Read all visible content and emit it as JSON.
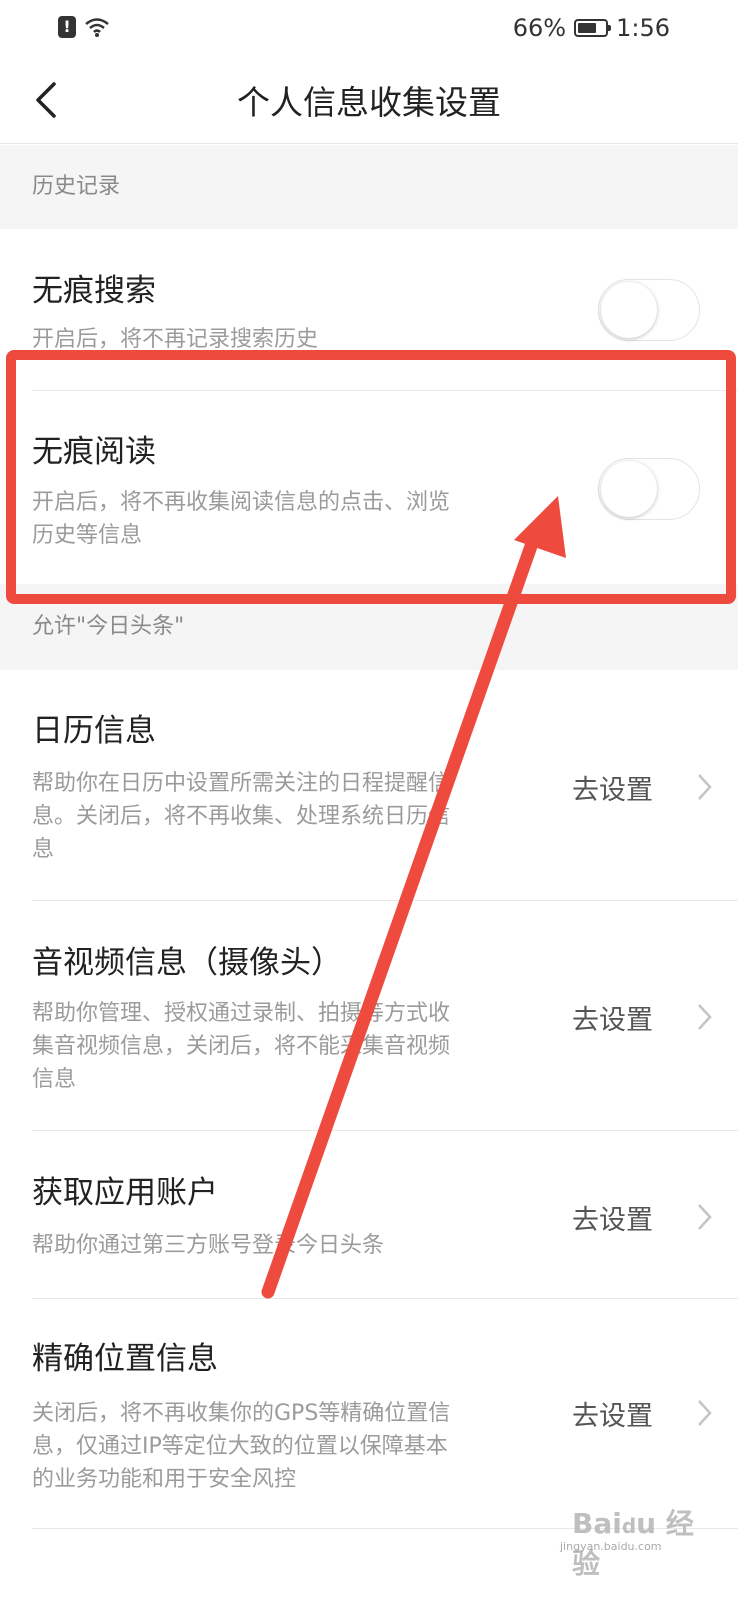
{
  "status_bar": {
    "battery_percent": "66%",
    "battery_level": 0.66,
    "time": "1:56",
    "icons": [
      "alert-icon",
      "wifi-icon",
      "battery-icon"
    ]
  },
  "header": {
    "title": "个人信息收集设置",
    "back_icon": "chevron-left-icon"
  },
  "sections": {
    "history": {
      "label": "历史记录"
    },
    "allow": {
      "label": "允许\"今日头条\""
    }
  },
  "toggles": [
    {
      "title": "无痕搜索",
      "desc": "开启后，将不再记录搜索历史",
      "on": false
    },
    {
      "title": "无痕阅读",
      "desc_line1": "开启后，将不再收集阅读信息的点击、浏览",
      "desc_line2": "历史等信息",
      "on": false
    }
  ],
  "settings": [
    {
      "title": "日历信息",
      "desc_lines": [
        "帮助你在日历中设置所需关注的日程提醒信",
        "息。关闭后，将不再收集、处理系统日历信",
        "息"
      ],
      "action": "去设置"
    },
    {
      "title": "音视频信息（摄像头）",
      "desc_lines": [
        "帮助你管理、授权通过录制、拍摄等方式收",
        "集音视频信息，关闭后，将不能采集音视频",
        "信息"
      ],
      "action": "去设置"
    },
    {
      "title": "获取应用账户",
      "desc_lines": [
        "帮助你通过第三方账号登录今日头条"
      ],
      "action": "去设置"
    },
    {
      "title": "精确位置信息",
      "desc_lines": [
        "关闭后，将不再收集你的GPS等精确位置信",
        "息，仅通过IP等定位大致的位置以保障基本",
        "的业务功能和用于安全风控"
      ],
      "action": "去设置"
    }
  ],
  "annotation": {
    "color": "#ee4b3e"
  },
  "watermark": {
    "main": "Baidu经验",
    "sub": "jingyan.baidu.com"
  }
}
